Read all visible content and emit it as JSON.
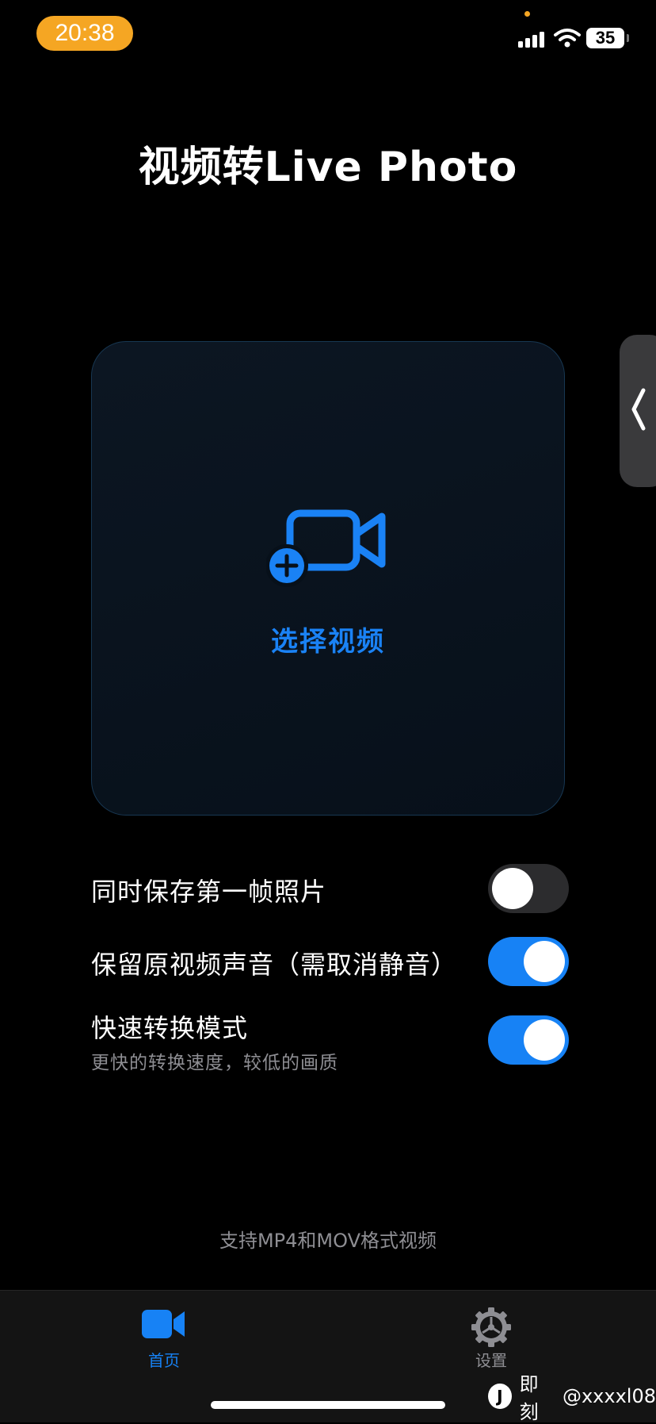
{
  "status_bar": {
    "time": "20:38",
    "battery": "35"
  },
  "header": {
    "title": "视频转Live Photo"
  },
  "select_card": {
    "label": "选择视频"
  },
  "options": [
    {
      "label": "同时保存第一帧照片",
      "enabled": false
    },
    {
      "label": "保留原视频声音（需取消静音）",
      "enabled": true
    },
    {
      "label": "快速转换模式",
      "sublabel": "更快的转换速度，较低的画质",
      "enabled": true
    }
  ],
  "footer_note": "支持MP4和MOV格式视频",
  "tab_bar": {
    "tabs": [
      {
        "label": "首页",
        "icon": "video-camera-icon",
        "active": true
      },
      {
        "label": "设置",
        "icon": "gear-icon",
        "active": false
      }
    ]
  },
  "watermark": {
    "brand": "即刻",
    "user": "@xxxxl08"
  },
  "colors": {
    "accent": "#1782f5",
    "status_pill": "#f5a623",
    "toggle_off": "#2c2c2e"
  }
}
